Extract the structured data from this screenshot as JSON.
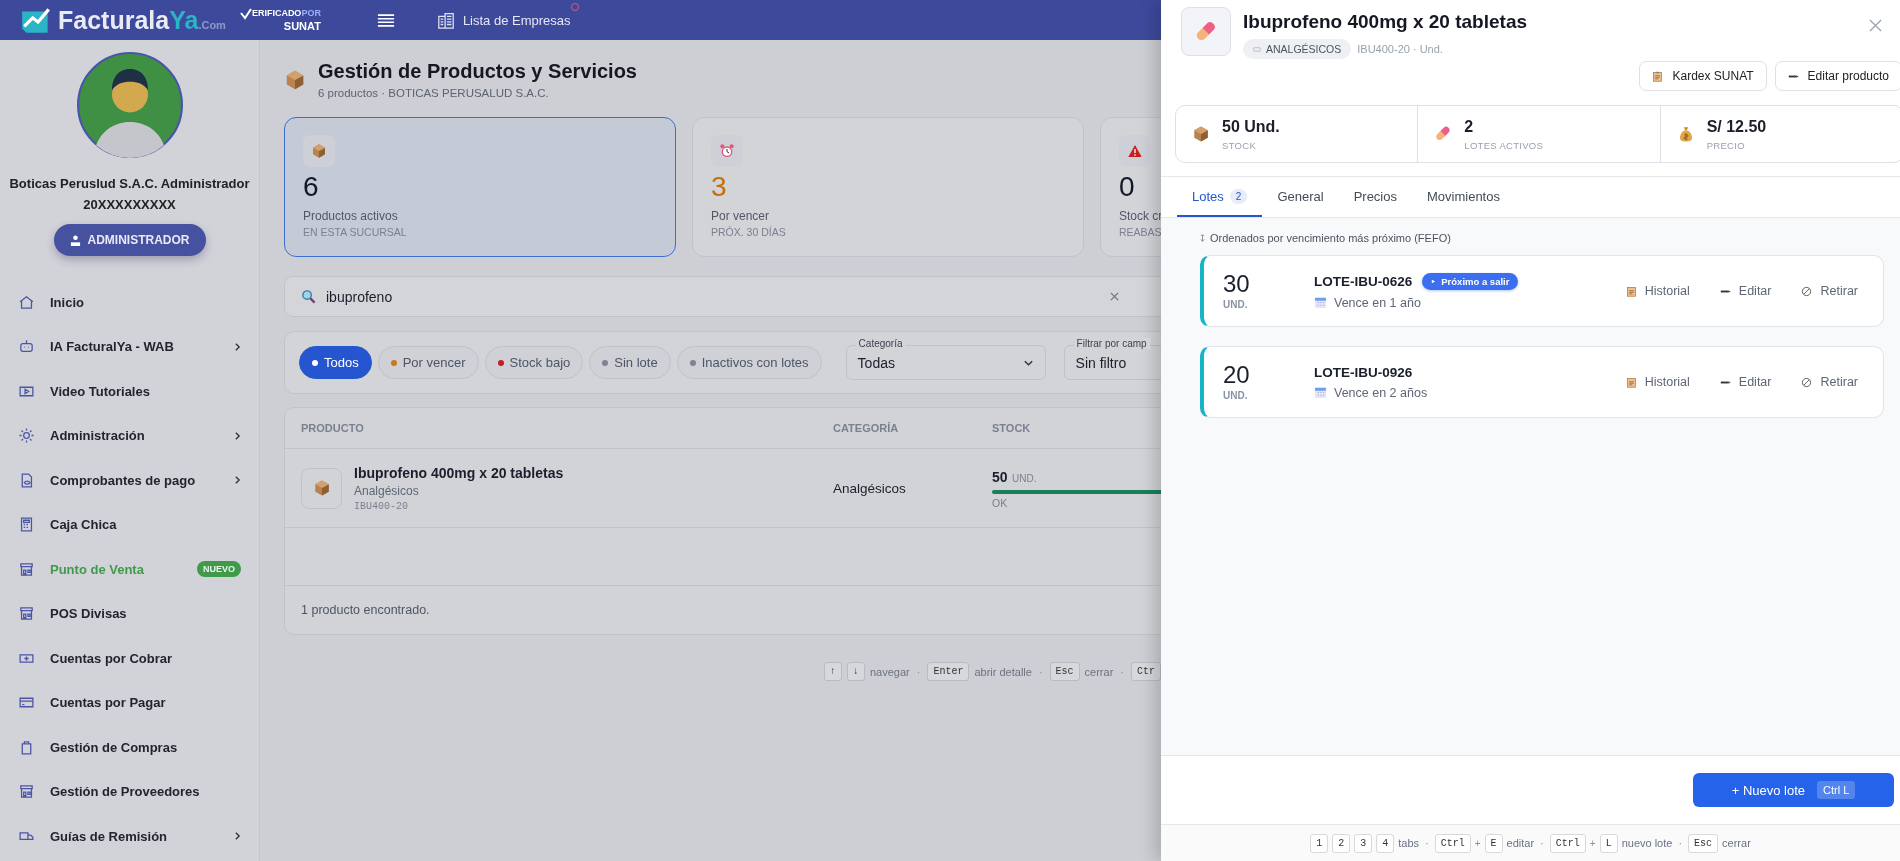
{
  "header": {
    "logo_main": "Facturala",
    "logo_accent": "Ya",
    "logo_suffix": ".Com",
    "verified_text": "ERIFICADO",
    "verified_por": "POR",
    "verified_brand": "SUNAT",
    "companies_link": "Lista de Empresas",
    "notification": true
  },
  "profile": {
    "name": "Boticas Peruslud S.A.C. Administrador",
    "ruc": "20XXXXXXXXX",
    "role": "ADMINISTRADOR"
  },
  "sidebar": {
    "items": [
      {
        "label": "Inicio",
        "submenu": false,
        "highlighted": false
      },
      {
        "label": "IA FacturalYa - WAB",
        "submenu": true,
        "highlighted": false
      },
      {
        "label": "Video Tutoriales",
        "submenu": false,
        "highlighted": false
      },
      {
        "label": "Administración",
        "submenu": true,
        "highlighted": false
      },
      {
        "label": "Comprobantes de pago",
        "submenu": true,
        "highlighted": false
      },
      {
        "label": "Caja Chica",
        "submenu": false,
        "highlighted": false
      },
      {
        "label": "Punto de Venta",
        "submenu": false,
        "highlighted": true,
        "badge": "NUEVO"
      },
      {
        "label": "POS Divisas",
        "submenu": false,
        "highlighted": false
      },
      {
        "label": "Cuentas por Cobrar",
        "submenu": false,
        "highlighted": false
      },
      {
        "label": "Cuentas por Pagar",
        "submenu": false,
        "highlighted": false
      },
      {
        "label": "Gestión de Compras",
        "submenu": false,
        "highlighted": false
      },
      {
        "label": "Gestión de Proveedores",
        "submenu": false,
        "highlighted": false
      },
      {
        "label": "Guías de Remisión",
        "submenu": true,
        "highlighted": false
      }
    ]
  },
  "page": {
    "title": "Gestión de Productos y Servicios",
    "subtitle": "6 productos · BOTICAS PERUSALUD S.A.C."
  },
  "stats": [
    {
      "value": "6",
      "label": "Productos activos",
      "sublabel": "EN ESTA SUCURSAL",
      "selected": true,
      "color": "#111827"
    },
    {
      "value": "3",
      "label": "Por vencer",
      "sublabel": "PRÓX. 30 DÍAS",
      "selected": false,
      "color": "#c2700e"
    },
    {
      "value": "0",
      "label": "Stock cr",
      "sublabel": "REABAS",
      "selected": false,
      "color": "#111827"
    }
  ],
  "search": {
    "value": "ibuprofeno"
  },
  "filters": {
    "chips": [
      {
        "label": "Todos",
        "selected": true,
        "color": "#ffffff"
      },
      {
        "label": "Por vencer",
        "selected": false,
        "color": "#c97a16"
      },
      {
        "label": "Stock bajo",
        "selected": false,
        "color": "#c81e1e"
      },
      {
        "label": "Sin lote",
        "selected": false,
        "color": "#7b8394"
      },
      {
        "label": "Inactivos con lotes",
        "selected": false,
        "color": "#7b8394"
      }
    ],
    "category": {
      "label": "Categoría",
      "value": "Todas"
    },
    "field_filter": {
      "label": "Filtrar por camp",
      "value": "Sin filtro"
    }
  },
  "table": {
    "columns": [
      "PRODUCTO",
      "CATEGORÍA",
      "STOCK"
    ],
    "rows": [
      {
        "name": "Ibuprofeno 400mg x 20 tabletas",
        "subcategory": "Analgésicos",
        "sku": "IBU400-20",
        "category": "Analgésicos",
        "stock": "50",
        "unit": "UND.",
        "status": "OK",
        "level": 1
      }
    ],
    "footer": "1 producto encontrado."
  },
  "shortcuts": [
    {
      "kind": "key",
      "text": "↑"
    },
    {
      "kind": "key",
      "text": "↓"
    },
    {
      "kind": "label",
      "text": "navegar"
    },
    {
      "kind": "sep",
      "text": "·"
    },
    {
      "kind": "key",
      "text": "Enter"
    },
    {
      "kind": "label",
      "text": "abrir detalle"
    },
    {
      "kind": "sep",
      "text": "·"
    },
    {
      "kind": "key",
      "text": "Esc"
    },
    {
      "kind": "label",
      "text": "cerrar"
    },
    {
      "kind": "sep",
      "text": "·"
    },
    {
      "kind": "key",
      "text": "Ctr"
    }
  ],
  "drawer": {
    "title": "Ibuprofeno 400mg x 20 tabletas",
    "tag": "ANALGÉSICOS",
    "meta": "IBU400-20 · Und.",
    "actions": [
      "Kardex SUNAT",
      "Editar producto"
    ],
    "stats": [
      {
        "value": "50 Und.",
        "label": "STOCK"
      },
      {
        "value": "2",
        "label": "LOTES ACTIVOS"
      },
      {
        "value": "S/ 12.50",
        "label": "PRECIO"
      }
    ],
    "tabs": [
      {
        "label": "Lotes",
        "count": "2",
        "selected": true
      },
      {
        "label": "General",
        "selected": false
      },
      {
        "label": "Precios",
        "selected": false
      },
      {
        "label": "Movimientos",
        "selected": false
      }
    ],
    "sort_note": "Ordenados por vencimiento más próximo (FEFO)",
    "lots": [
      {
        "qty": "30",
        "unit": "UND.",
        "code": "LOTE-IBU-0626",
        "badge": "Próximo a salir",
        "expiry": "Vence en 1 año",
        "actions": [
          "Historial",
          "Editar",
          "Retirar"
        ]
      },
      {
        "qty": "20",
        "unit": "UND.",
        "code": "LOTE-IBU-0926",
        "expiry": "Vence en 2 años",
        "actions": [
          "Historial",
          "Editar",
          "Retirar"
        ]
      }
    ],
    "primary": {
      "label": "+ Nuevo lote",
      "shortcut": "Ctrl L"
    },
    "shortcuts": [
      {
        "kind": "key",
        "text": "1"
      },
      {
        "kind": "key",
        "text": "2"
      },
      {
        "kind": "key",
        "text": "3"
      },
      {
        "kind": "key",
        "text": "4"
      },
      {
        "kind": "label",
        "text": "tabs"
      },
      {
        "kind": "sep",
        "text": "·"
      },
      {
        "kind": "key",
        "text": "Ctrl"
      },
      {
        "kind": "plus",
        "text": "+"
      },
      {
        "kind": "key",
        "text": "E"
      },
      {
        "kind": "label",
        "text": "editar"
      },
      {
        "kind": "sep",
        "text": "·"
      },
      {
        "kind": "key",
        "text": "Ctrl"
      },
      {
        "kind": "plus",
        "text": "+"
      },
      {
        "kind": "key",
        "text": "L"
      },
      {
        "kind": "label",
        "text": "nuevo lote"
      },
      {
        "kind": "sep",
        "text": "·"
      },
      {
        "kind": "key",
        "text": "Esc"
      },
      {
        "kind": "label",
        "text": "cerrar"
      }
    ]
  }
}
